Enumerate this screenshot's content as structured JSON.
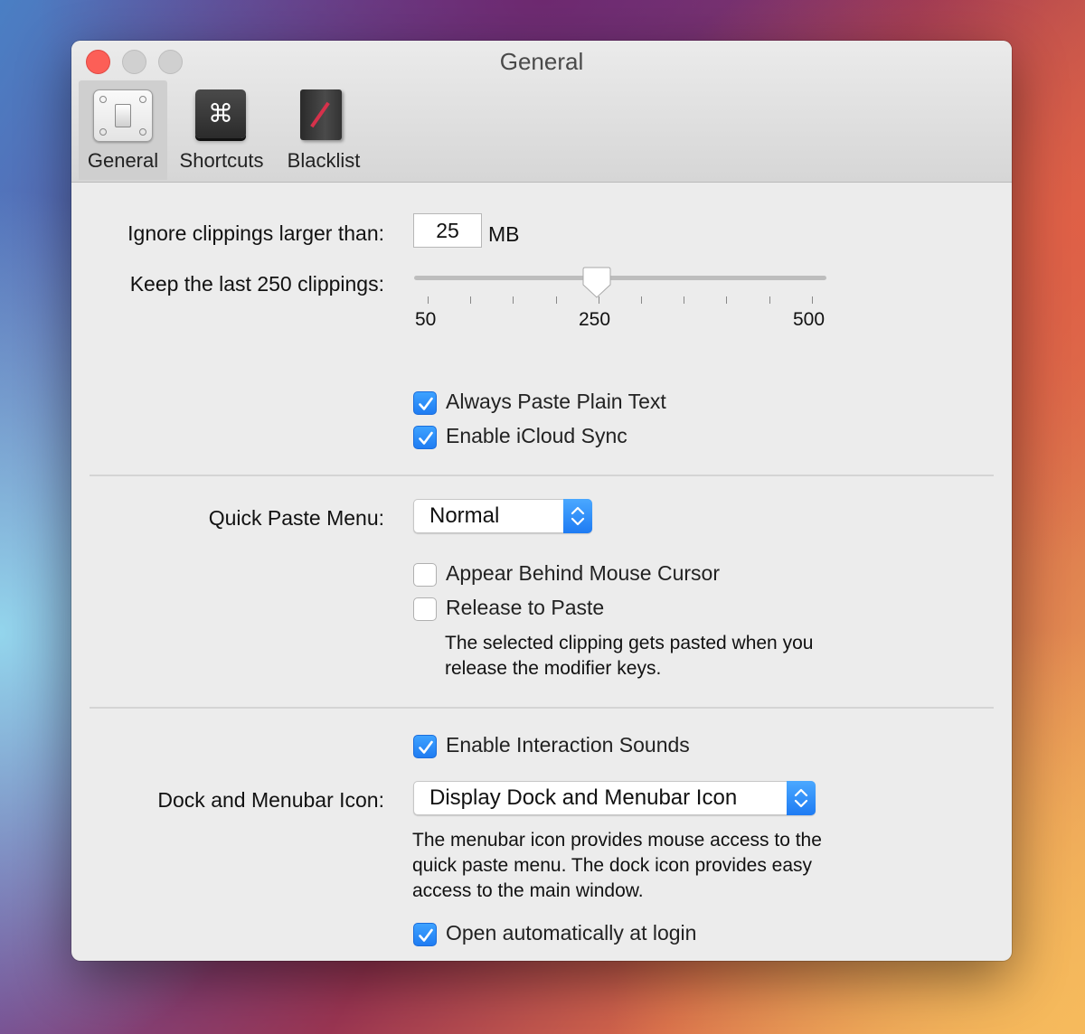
{
  "window": {
    "title": "General"
  },
  "toolbar": {
    "items": [
      {
        "label": "General",
        "icon": "switch-icon",
        "selected": true
      },
      {
        "label": "Shortcuts",
        "icon": "command-key-icon",
        "selected": false
      },
      {
        "label": "Blacklist",
        "icon": "blacklist-book-icon",
        "selected": false
      }
    ],
    "command_glyph": "⌘"
  },
  "general": {
    "ignore_label": "Ignore clippings larger than:",
    "ignore_value": "25",
    "ignore_unit": "MB",
    "keep_label": "Keep the last 250 clippings:",
    "slider": {
      "min": 50,
      "max": 500,
      "value": 250,
      "tick_labels": [
        "50",
        "250",
        "500"
      ]
    },
    "plain_text_label": "Always Paste Plain Text",
    "plain_text_checked": true,
    "icloud_label": "Enable iCloud Sync",
    "icloud_checked": true
  },
  "quick_paste": {
    "label": "Quick Paste Menu:",
    "selected": "Normal",
    "behind_cursor_label": "Appear Behind Mouse Cursor",
    "behind_cursor_checked": false,
    "release_label": "Release to Paste",
    "release_checked": false,
    "release_desc": [
      "The selected clipping gets pasted when you",
      "release the modifier keys."
    ]
  },
  "misc": {
    "sounds_label": "Enable Interaction Sounds",
    "sounds_checked": true,
    "dock_label": "Dock and Menubar Icon:",
    "dock_selected": "Display Dock and Menubar Icon",
    "dock_desc": [
      "The menubar icon provides mouse access to the",
      "quick paste menu. The dock icon provides easy",
      "access to the main window."
    ],
    "login_label": "Open automatically at login",
    "login_checked": true
  },
  "colors": {
    "accent": "#1f7cf2",
    "close": "#fc5f57",
    "blacklist_slash": "#d6314b"
  }
}
